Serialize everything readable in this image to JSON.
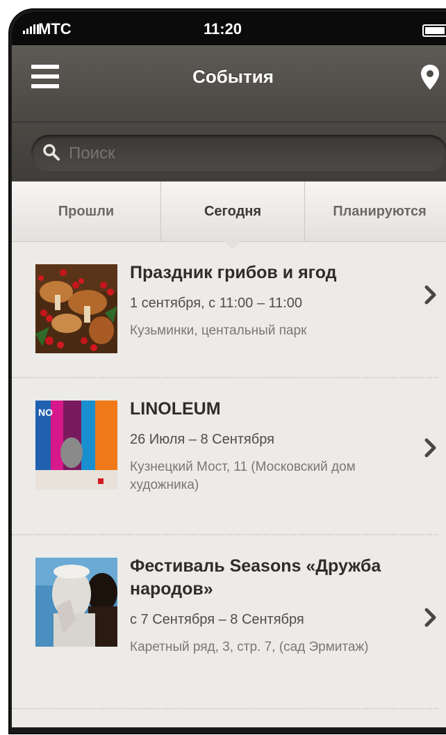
{
  "status_bar": {
    "carrier": "МТС",
    "time": "11:20"
  },
  "navbar": {
    "title": "События",
    "left_icon": "hamburger-menu-icon",
    "right_icon": "location-pin-icon"
  },
  "search": {
    "placeholder": "Поиск",
    "icon": "search-icon"
  },
  "tabs": [
    {
      "label": "Прошли",
      "active": false
    },
    {
      "label": "Сегодня",
      "active": true
    },
    {
      "label": "Планируются",
      "active": false
    }
  ],
  "events": [
    {
      "title": "Праздник грибов и ягод",
      "date": "1 сентября, с 11:00 – 11:00",
      "place": "Кузьминки, центальный парк"
    },
    {
      "title": "LINOLEUM",
      "date": "26 Июля – 8 Сентября",
      "place": "Кузнецкий Мост, 11 (Московский дом художника)"
    },
    {
      "title": "Фестиваль Seasons «Дружба народов»",
      "date": "с 7 Сентября – 8 Сентября",
      "place": "Каретный ряд, 3, стр. 7, (сад Эрмитаж)"
    }
  ],
  "colors": {
    "navbar": "#4a4743",
    "background": "#ecebe8",
    "title_text": "#2f2d2b"
  }
}
